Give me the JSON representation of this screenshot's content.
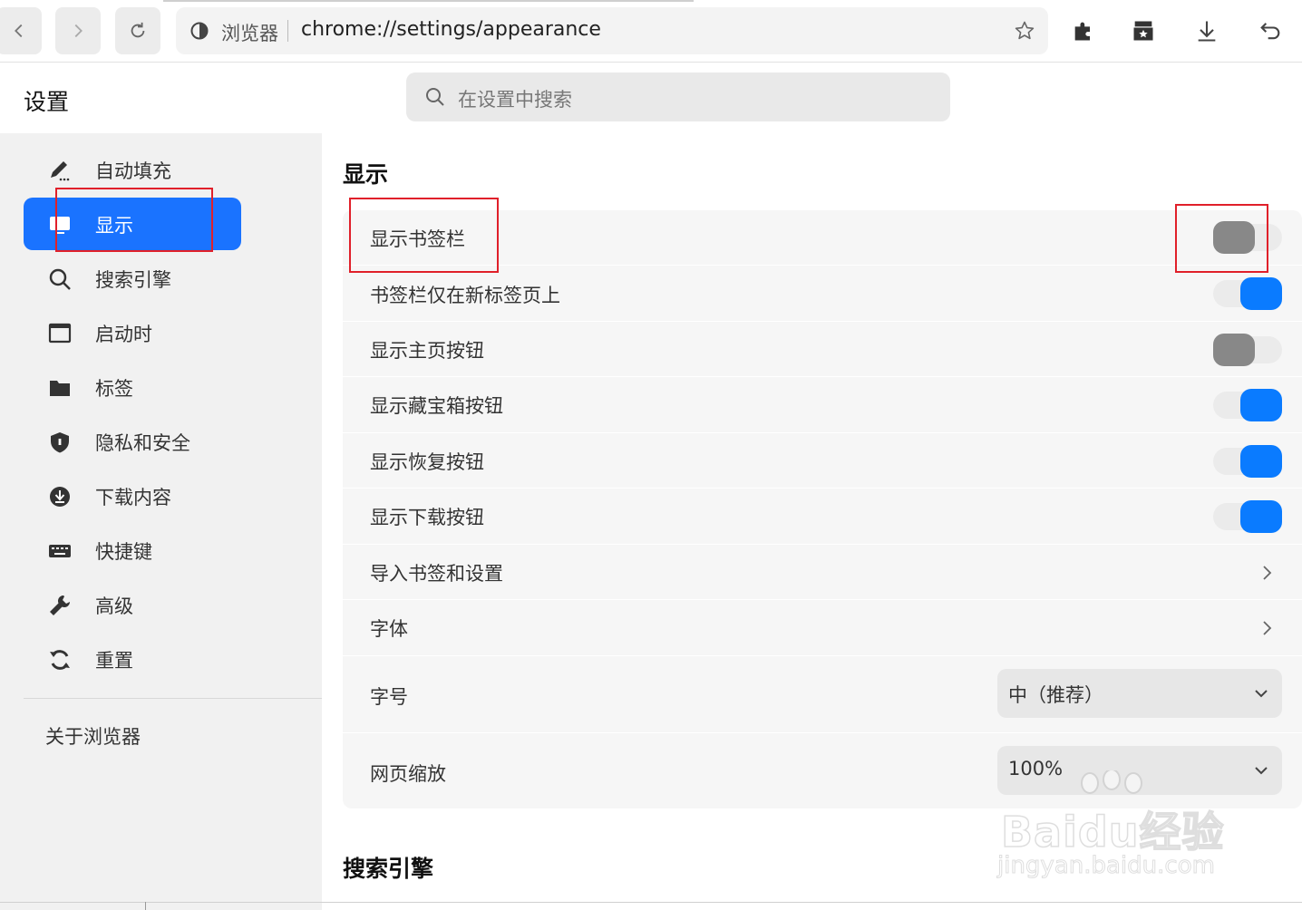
{
  "browser": {
    "site_label": "浏览器",
    "url": "chrome://settings/appearance"
  },
  "header": {
    "title": "设置",
    "search_placeholder": "在设置中搜索"
  },
  "sidebar": {
    "items": [
      {
        "label": "自动填充",
        "icon": "pen-icon"
      },
      {
        "label": "显示",
        "icon": "monitor-icon",
        "active": true
      },
      {
        "label": "搜索引擎",
        "icon": "search-icon"
      },
      {
        "label": "启动时",
        "icon": "window-icon"
      },
      {
        "label": "标签",
        "icon": "folder-icon"
      },
      {
        "label": "隐私和安全",
        "icon": "shield-icon"
      },
      {
        "label": "下载内容",
        "icon": "download-icon"
      },
      {
        "label": "快捷键",
        "icon": "keyboard-icon"
      },
      {
        "label": "高级",
        "icon": "wrench-icon"
      },
      {
        "label": "重置",
        "icon": "reset-icon"
      }
    ],
    "about": "关于浏览器"
  },
  "display": {
    "title": "显示",
    "rows": [
      {
        "label": "显示书签栏",
        "toggle": false
      },
      {
        "label": "书签栏仅在新标签页上",
        "toggle": true
      },
      {
        "label": "显示主页按钮",
        "toggle": false
      },
      {
        "label": "显示藏宝箱按钮",
        "toggle": true
      },
      {
        "label": "显示恢复按钮",
        "toggle": true
      },
      {
        "label": "显示下载按钮",
        "toggle": true
      },
      {
        "label": "导入书签和设置"
      },
      {
        "label": "字体"
      },
      {
        "label": "字号",
        "value": "中（推荐）"
      },
      {
        "label": "网页缩放",
        "value": "100%"
      }
    ]
  },
  "search_engine_section": {
    "title": "搜索引擎"
  },
  "watermark": {
    "brand": "Baidu经验",
    "url": "jingyan.baidu.com"
  },
  "colors": {
    "accent": "#1a73ff",
    "toggle_on": "#0a7bff",
    "toggle_off": "#888888",
    "highlight": "#e0202a"
  }
}
